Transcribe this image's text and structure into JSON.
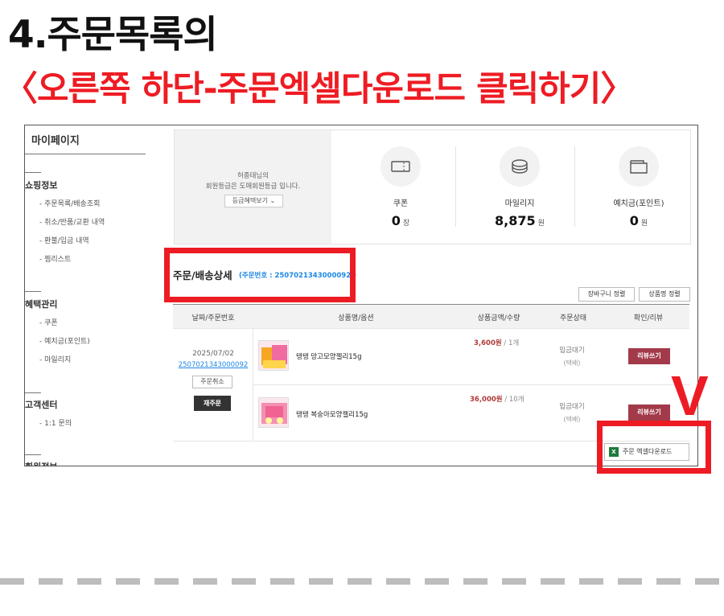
{
  "heading": {
    "line1": "4.주문목록의",
    "line2": "〈오른쪽 하단-주문엑셀다운로드 클릭하기〉"
  },
  "sidebar": {
    "title": "마이페이지",
    "sections": [
      {
        "title": "쇼핑정보",
        "items": [
          "주문목록/배송조회",
          "취소/반품/교환 내역",
          "환불/입금 내역",
          "찜리스트"
        ]
      },
      {
        "title": "혜택관리",
        "items": [
          "쿠폰",
          "예치금(포인트)",
          "마일리지"
        ]
      },
      {
        "title": "고객센터",
        "items": [
          "1:1 문의"
        ]
      },
      {
        "title": "회원정보",
        "items": []
      }
    ]
  },
  "summary": {
    "grade_line1": "허종태님의",
    "grade_line2": "회원등급은 도매회원등급 입니다.",
    "grade_button": "등급혜택보기 ⌄",
    "stats": [
      {
        "icon": "ticket-icon",
        "label": "쿠폰",
        "value": "0",
        "unit": "장"
      },
      {
        "icon": "coin-stack-icon",
        "label": "마일리지",
        "value": "8,875",
        "unit": "원"
      },
      {
        "icon": "wallet-icon",
        "label": "예치금(포인트)",
        "value": "0",
        "unit": "원"
      }
    ]
  },
  "order_detail": {
    "title": "주문/배송상세",
    "order_number_label": "(주문번호 : 2507021343000092 )",
    "sort_buttons": [
      "장바구니 정렬",
      "상품명 정렬"
    ],
    "columns": [
      "날짜/주문번호",
      "상품명/옵션",
      "상품금액/수량",
      "주문상태",
      "확인/리뷰"
    ],
    "order": {
      "date": "2025/07/02",
      "number": "2507021343000092",
      "cancel_button": "주문취소",
      "reorder_button": "재주문"
    },
    "items": [
      {
        "name": "탱탱 망고모양젤리15g",
        "price": "3,600원",
        "qty": "/ 1개",
        "status": "입금대기",
        "delivery": "(택배)",
        "review_button": "리뷰쓰기"
      },
      {
        "name": "탱탱 복숭아모양젤리15g",
        "price": "36,000원",
        "qty": "/ 10개",
        "status": "입금대기",
        "delivery": "(택배)",
        "review_button": "리뷰쓰기"
      }
    ],
    "excel_button": "주문 엑셀다운로드",
    "excel_icon": "X"
  },
  "annotation": {
    "mark": "V",
    "color": "#ed1c24"
  }
}
